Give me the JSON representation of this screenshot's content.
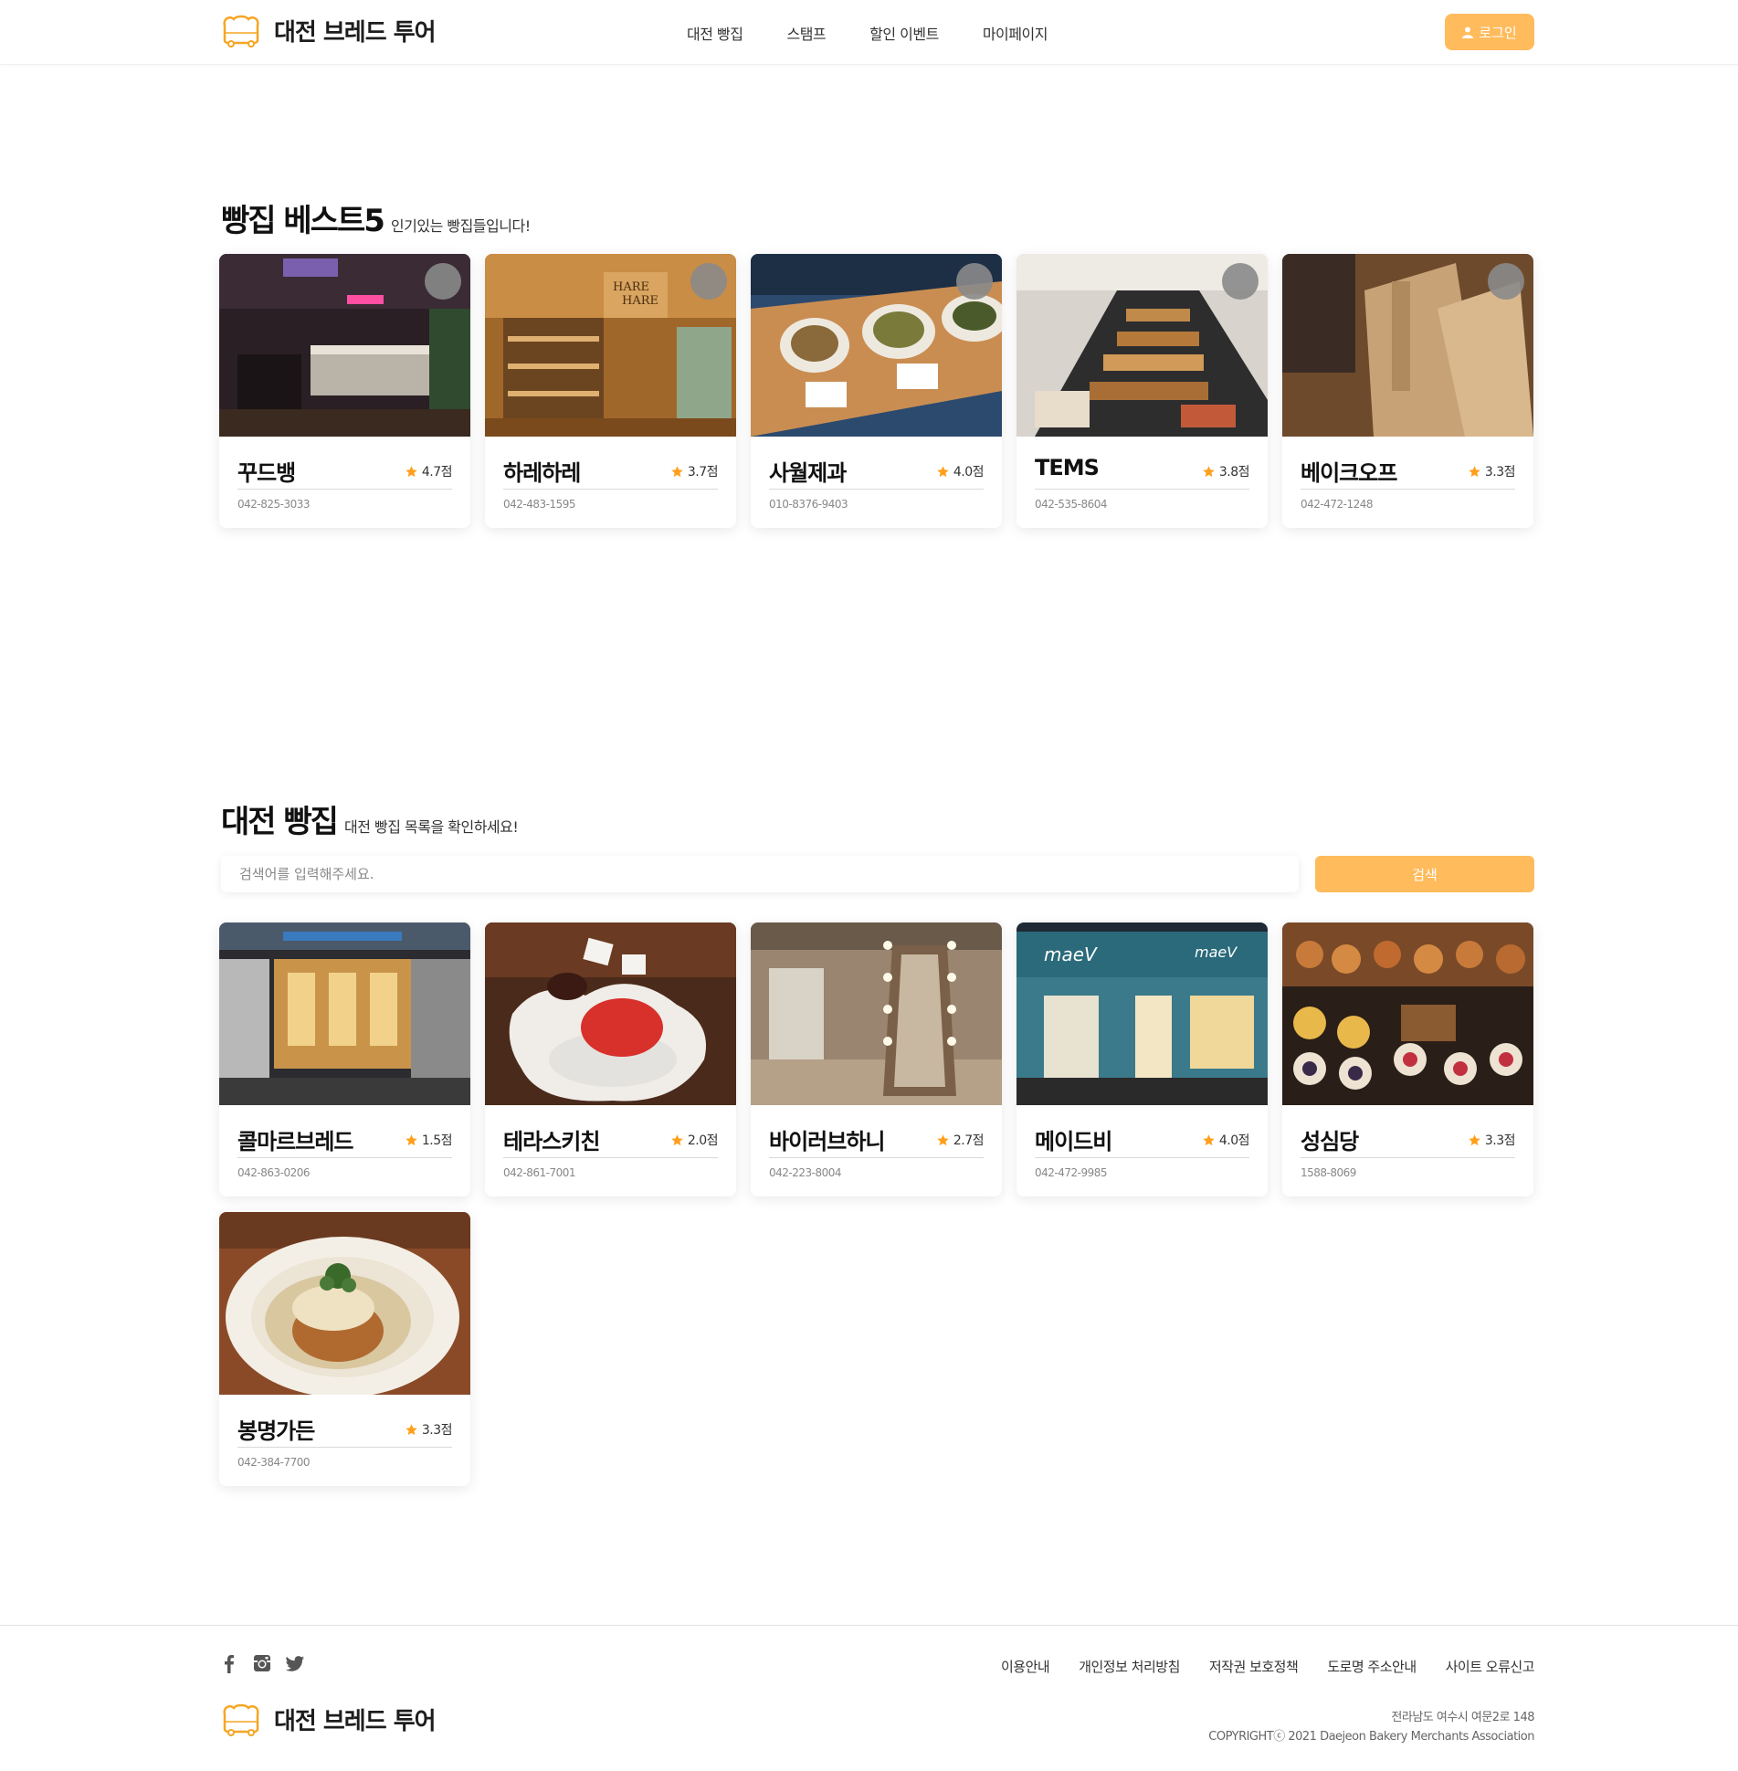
{
  "header": {
    "brand": "대전 브레드 투어",
    "nav": [
      "대전 빵집",
      "스탬프",
      "할인 이벤트",
      "마이페이지"
    ],
    "login_label": "로그인"
  },
  "best": {
    "title": "빵집 베스트5",
    "subtitle": "인기있는 빵집들입니다!",
    "items": [
      {
        "name": "꾸드뱅",
        "rating": "4.7점",
        "phone": "042-825-3033"
      },
      {
        "name": "하레하레",
        "rating": "3.7점",
        "phone": "042-483-1595"
      },
      {
        "name": "사월제과",
        "rating": "4.0점",
        "phone": "010-8376-9403"
      },
      {
        "name": "TEMS",
        "rating": "3.8점",
        "phone": "042-535-8604"
      },
      {
        "name": "베이크오프",
        "rating": "3.3점",
        "phone": "042-472-1248"
      }
    ]
  },
  "list": {
    "title": "대전 빵집",
    "subtitle": "대전 빵집 목록을 확인하세요!",
    "search_placeholder": "검색어를 입력해주세요.",
    "search_label": "검색",
    "items": [
      {
        "name": "콜마르브레드",
        "rating": "1.5점",
        "phone": "042-863-0206"
      },
      {
        "name": "테라스키친",
        "rating": "2.0점",
        "phone": "042-861-7001"
      },
      {
        "name": "바이러브하니",
        "rating": "2.7점",
        "phone": "042-223-8004"
      },
      {
        "name": "메이드비",
        "rating": "4.0점",
        "phone": "042-472-9985"
      },
      {
        "name": "성심당",
        "rating": "3.3점",
        "phone": "1588-8069"
      },
      {
        "name": "봉명가든",
        "rating": "3.3점",
        "phone": "042-384-7700"
      }
    ]
  },
  "footer": {
    "social": [
      "facebook-icon",
      "instagram-icon",
      "twitter-icon"
    ],
    "links": [
      "이용안내",
      "개인정보 처리방침",
      "저작권 보호정책",
      "도로명 주소안내",
      "사이트 오류신고"
    ],
    "brand": "대전 브레드 투어",
    "address": "전라남도 여수시 여문2로 148",
    "copyright": "COPYRIGHTⓒ 2021 Daejeon Bakery Merchants Association"
  },
  "colors": {
    "accent": "#ffbb5c",
    "star": "#ff9f1a",
    "heart_bg": "#8a8a8a"
  }
}
